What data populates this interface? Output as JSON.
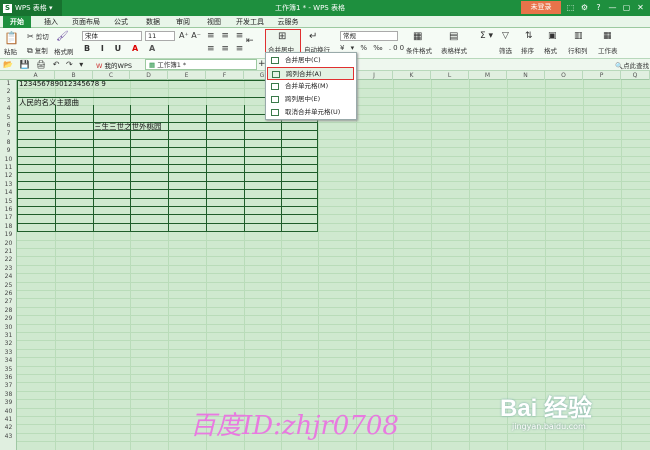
{
  "app": {
    "logo": "WPS 表格",
    "logo_s": "S",
    "window_title": "工作簿1 * - WPS 表格",
    "login": "未登录"
  },
  "window_buttons": [
    "⬚",
    "⚙",
    "?",
    "—",
    "▢",
    "✕"
  ],
  "tabs": [
    "开始",
    "插入",
    "页面布局",
    "公式",
    "数据",
    "审阅",
    "视图",
    "开发工具",
    "云服务"
  ],
  "ribbon": {
    "cut": "剪切",
    "copy": "复制",
    "paste": "粘贴",
    "format_painter": "格式刷",
    "font": "宋体",
    "font_size": "11",
    "merge_center": "合并居中",
    "wrap": "自动换行",
    "number_format": "常规",
    "conditional": "条件格式",
    "table_style": "表格样式",
    "filter": "筛选",
    "sort": "排序",
    "format": "格式",
    "rowcol": "行和列",
    "worksheet": "工作表",
    "percent": "%"
  },
  "quickbar": {
    "my_wps": "我的WPS",
    "book": "工作簿1 *",
    "add": "+",
    "search": "点此查找"
  },
  "columns": [
    "A",
    "B",
    "C",
    "D",
    "E",
    "F",
    "G",
    "H",
    "I",
    "J",
    "K",
    "L",
    "M",
    "N",
    "O",
    "P",
    "Q"
  ],
  "rows": [
    "1",
    "2",
    "3",
    "4",
    "5",
    "6",
    "7",
    "8",
    "9",
    "10",
    "11",
    "12",
    "13",
    "14",
    "15",
    "16",
    "17",
    "18",
    "19",
    "20",
    "21",
    "22",
    "23",
    "24",
    "25",
    "26",
    "27",
    "28",
    "29",
    "30",
    "31",
    "32",
    "33",
    "34",
    "35",
    "36",
    "37",
    "38",
    "39",
    "40",
    "41",
    "42",
    "43"
  ],
  "cells": {
    "a1": "123456789012345678 9",
    "a3": "人民的名义主题曲",
    "c6": "三生三世之世外桃园"
  },
  "menu": {
    "items": [
      "合并居中(C)",
      "跨列合并(A)",
      "合并单元格(M)",
      "跨列居中(E)",
      "取消合并单元格(U)"
    ]
  },
  "watermark": "百度ID:zhjr0708",
  "baidu": {
    "logo": "Bai 经验",
    "url": "jingyan.baidu.com"
  },
  "colors": {
    "titlebar": "#1e8f3e",
    "sheet_bg": "#cfe9cf",
    "highlight": "#e03030",
    "watermark": "#e87ae0"
  }
}
